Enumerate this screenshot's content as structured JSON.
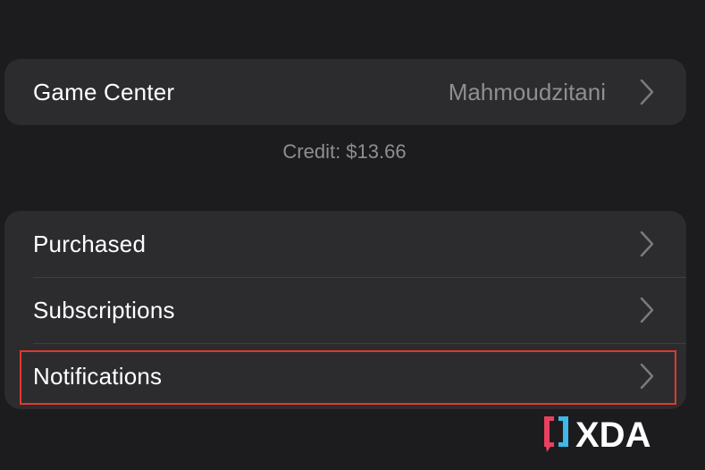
{
  "game_center": {
    "label": "Game Center",
    "value": "Mahmoudzitani",
    "chevron_icon": "chevron-right-icon"
  },
  "credit": "Credit: $13.66",
  "menu": {
    "items": [
      {
        "label": "Purchased",
        "icon": "chevron-right-icon"
      },
      {
        "label": "Subscriptions",
        "icon": "chevron-right-icon"
      },
      {
        "label": "Notifications",
        "icon": "chevron-right-icon",
        "highlighted": true
      }
    ]
  },
  "watermark": {
    "text": "XDA",
    "colors": {
      "bracket_left": "#e8405f",
      "bracket_right": "#3db8e8",
      "text": "#ffffff"
    }
  },
  "colors": {
    "background": "#1c1c1e",
    "cell": "#2c2c2e",
    "secondary_text": "#8e8e93",
    "highlight": "#e0392e"
  }
}
